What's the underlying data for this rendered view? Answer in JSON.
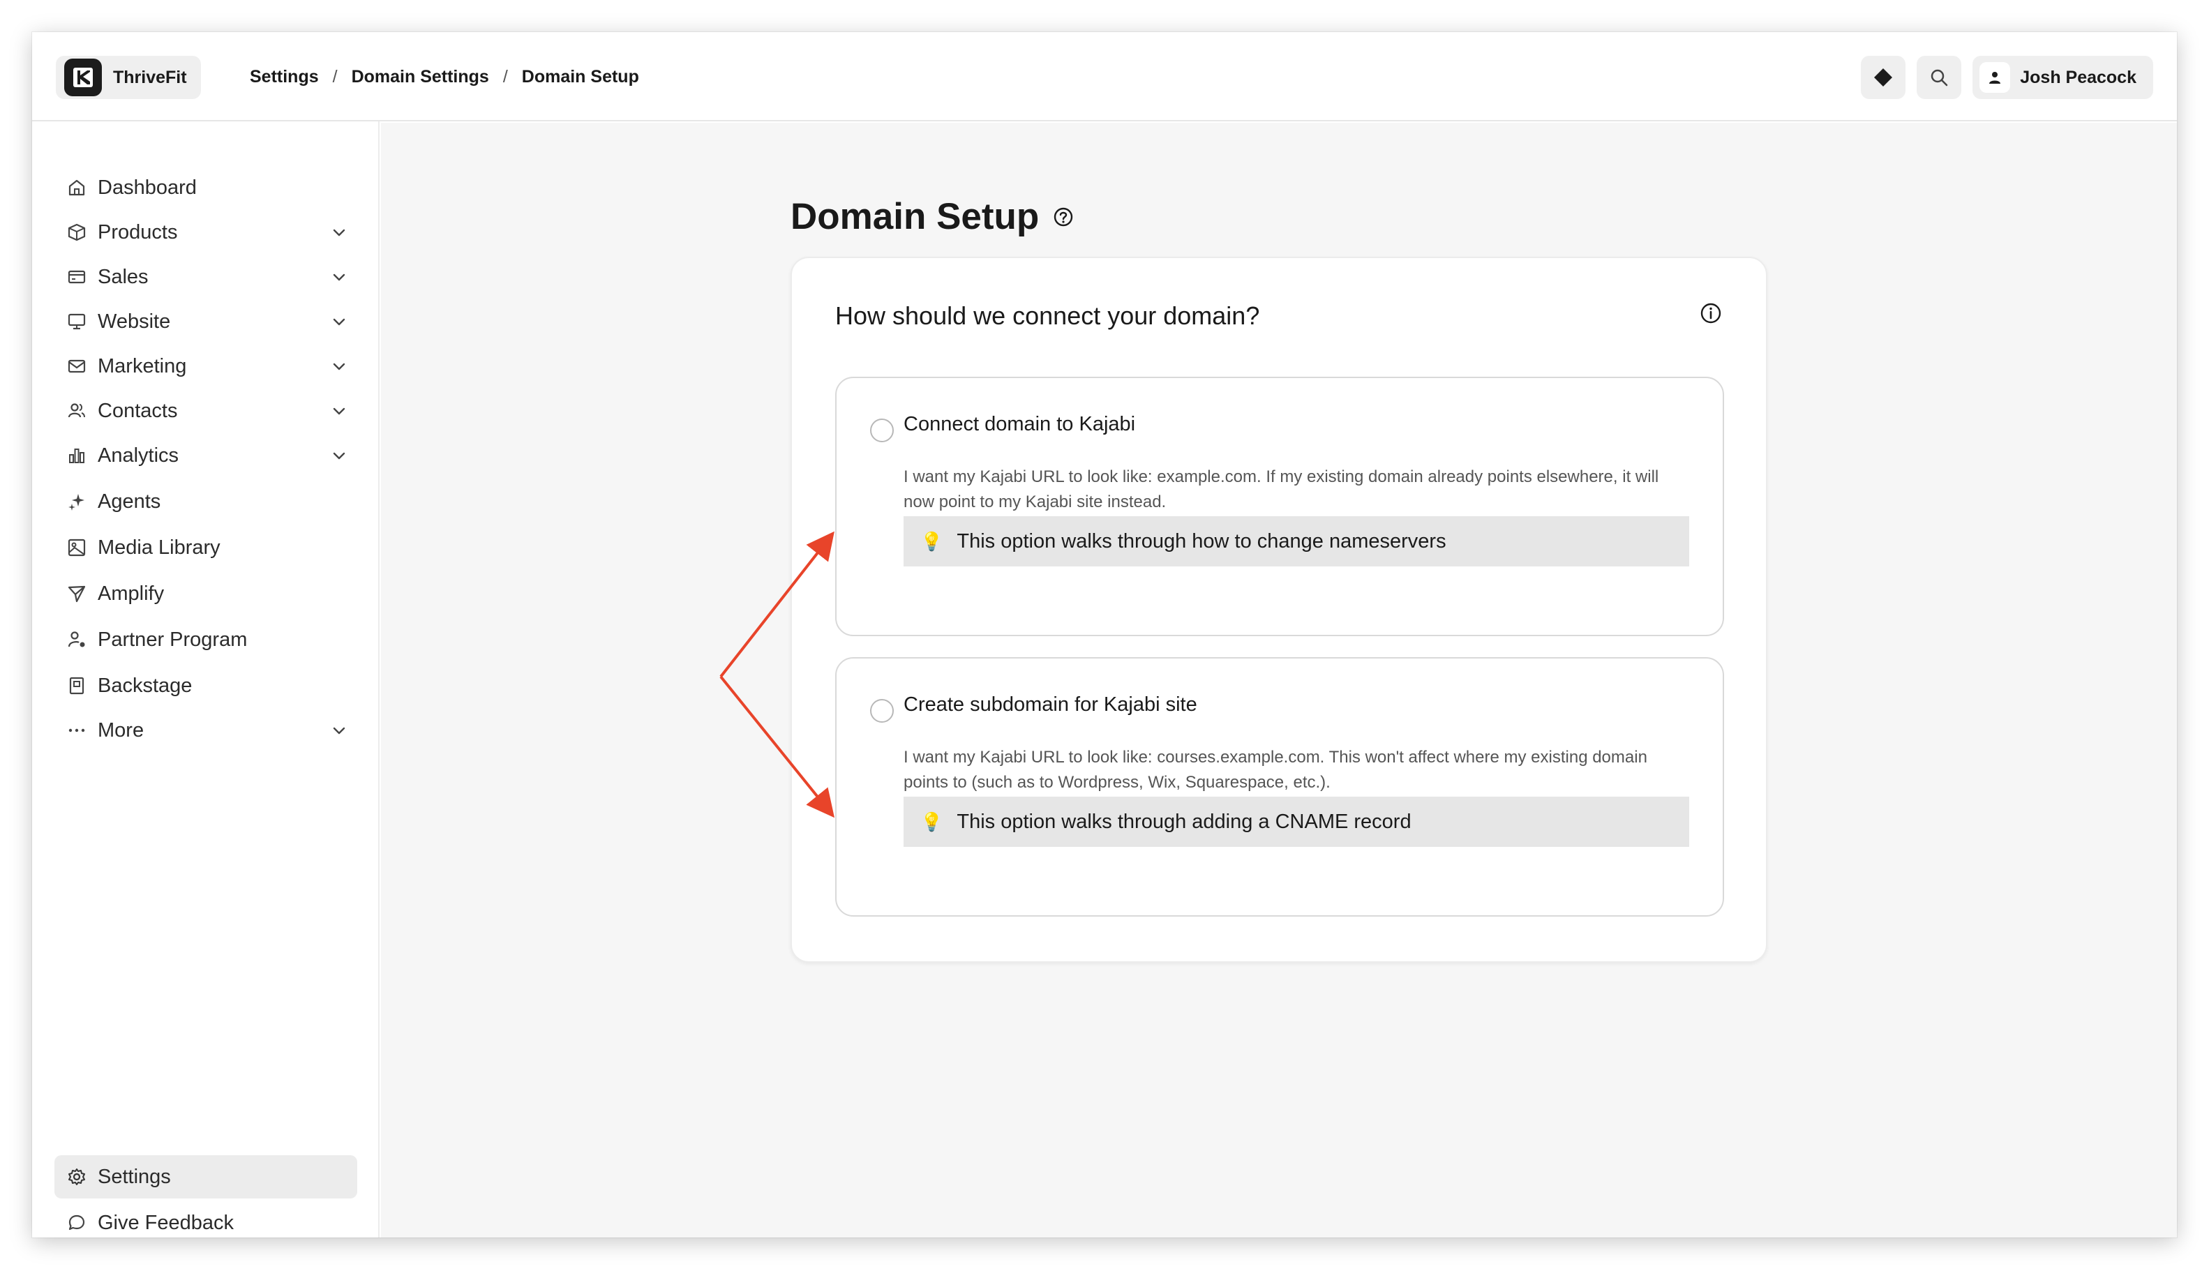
{
  "app": {
    "brand_name": "ThriveFit"
  },
  "breadcrumb": [
    "Settings",
    "Domain Settings",
    "Domain Setup"
  ],
  "header": {
    "user_name": "Josh Peacock"
  },
  "sidebar": {
    "items": [
      {
        "label": "Dashboard",
        "icon": "home-icon",
        "expandable": false
      },
      {
        "label": "Products",
        "icon": "box-icon",
        "expandable": true
      },
      {
        "label": "Sales",
        "icon": "credit-card-icon",
        "expandable": true
      },
      {
        "label": "Website",
        "icon": "monitor-icon",
        "expandable": true
      },
      {
        "label": "Marketing",
        "icon": "mail-icon",
        "expandable": true
      },
      {
        "label": "Contacts",
        "icon": "users-icon",
        "expandable": true
      },
      {
        "label": "Analytics",
        "icon": "bar-chart-icon",
        "expandable": true
      },
      {
        "label": "Agents",
        "icon": "sparkles-icon",
        "expandable": false
      },
      {
        "label": "Media Library",
        "icon": "image-icon",
        "expandable": false
      },
      {
        "label": "Amplify",
        "icon": "send-icon",
        "expandable": false
      },
      {
        "label": "Partner Program",
        "icon": "user-star-icon",
        "expandable": false
      },
      {
        "label": "Backstage",
        "icon": "book-icon",
        "expandable": false
      },
      {
        "label": "More",
        "icon": "more-icon",
        "expandable": true
      }
    ],
    "bottom": [
      {
        "label": "Settings",
        "icon": "gear-icon",
        "active": true
      },
      {
        "label": "Give Feedback",
        "icon": "chat-icon",
        "active": false
      }
    ]
  },
  "main": {
    "title": "Domain Setup",
    "card_title": "How should we connect your domain?",
    "options": [
      {
        "title": "Connect domain to Kajabi",
        "description": "I want my Kajabi URL to look like: example.com. If my existing domain already points elsewhere, it will now point to my Kajabi site instead.",
        "tip": "This option walks through how to change nameservers",
        "selected": false
      },
      {
        "title": "Create subdomain for Kajabi site",
        "description": "I want my Kajabi URL to look like: courses.example.com. This won't affect where my existing domain points to (such as to Wordpress, Wix, Squarespace, etc.).",
        "tip": "This option walks through adding a CNAME record",
        "selected": false
      }
    ]
  },
  "colors": {
    "annotation_arrow": "#e8442a",
    "active_nav_bg": "#ececec",
    "tip_bg": "#e6e6e6"
  }
}
